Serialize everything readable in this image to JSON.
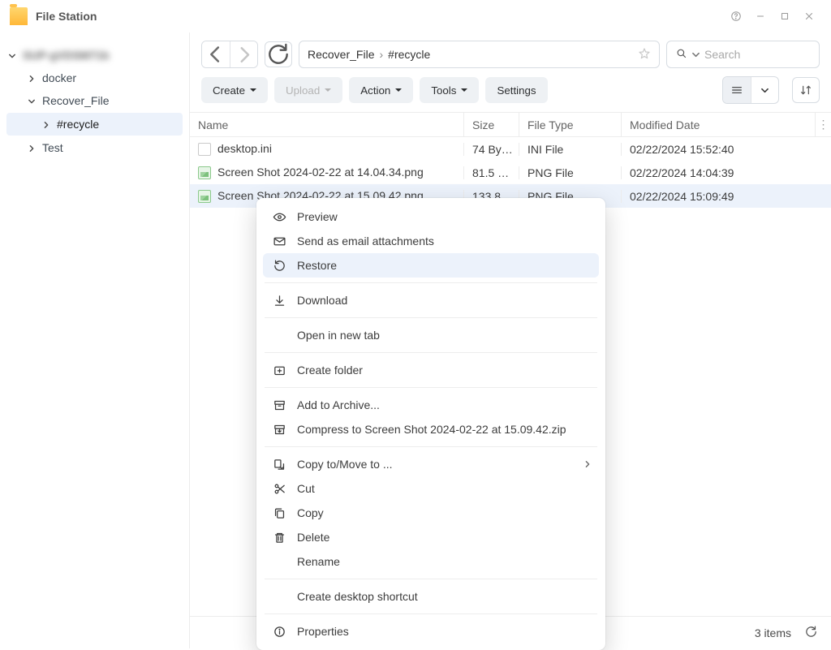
{
  "titlebar": {
    "app_title": "File Station"
  },
  "sidebar": {
    "root": "SUP-gVDSM71b",
    "items": [
      {
        "label": "docker",
        "expanded": false,
        "depth": 1,
        "selected": false
      },
      {
        "label": "Recover_File",
        "expanded": true,
        "depth": 1,
        "selected": false
      },
      {
        "label": "#recycle",
        "expanded": false,
        "depth": 2,
        "selected": true
      },
      {
        "label": "Test",
        "expanded": false,
        "depth": 1,
        "selected": false
      }
    ]
  },
  "path": {
    "segments": [
      "Recover_File",
      "#recycle"
    ]
  },
  "search": {
    "placeholder": "Search"
  },
  "toolbar": {
    "create": "Create",
    "upload": "Upload",
    "action": "Action",
    "tools": "Tools",
    "settings": "Settings"
  },
  "columns": {
    "name": "Name",
    "size": "Size",
    "type": "File Type",
    "modified": "Modified Date"
  },
  "rows": [
    {
      "name": "desktop.ini",
      "size": "74 By…",
      "type": "INI File",
      "modified": "02/22/2024 15:52:40",
      "kind": "ini",
      "selected": false
    },
    {
      "name": "Screen Shot 2024-02-22 at 14.04.34.png",
      "size": "81.5 …",
      "type": "PNG File",
      "modified": "02/22/2024 14:04:39",
      "kind": "png",
      "selected": false
    },
    {
      "name": "Screen Shot 2024-02-22 at 15.09.42.png",
      "size": "133.8…",
      "type": "PNG File",
      "modified": "02/22/2024 15:09:49",
      "kind": "png",
      "selected": true
    }
  ],
  "context_menu": {
    "preview": "Preview",
    "send_email": "Send as email attachments",
    "restore": "Restore",
    "download": "Download",
    "open_new_tab": "Open in new tab",
    "create_folder": "Create folder",
    "add_archive": "Add to Archive...",
    "compress_to": "Compress to Screen Shot 2024-02-22 at 15.09.42.zip",
    "copy_move": "Copy to/Move to ...",
    "cut": "Cut",
    "copy": "Copy",
    "delete": "Delete",
    "rename": "Rename",
    "desktop_shortcut": "Create desktop shortcut",
    "properties": "Properties"
  },
  "status": {
    "item_count": "3 items"
  }
}
